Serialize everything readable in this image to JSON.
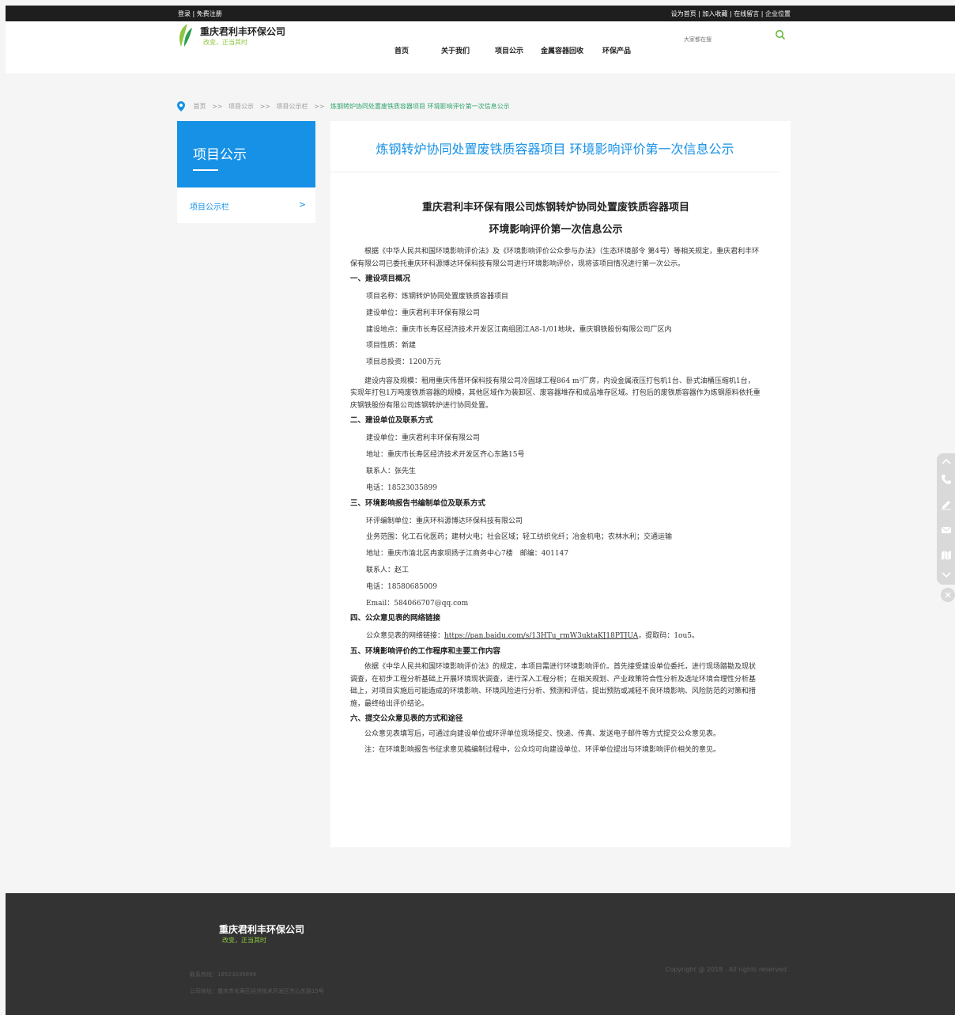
{
  "topbar": {
    "login": "登录",
    "register": "免费注册",
    "set_home": "设为首页",
    "favorite": "加入收藏",
    "message": "在线留言",
    "location": "企业位置",
    "sep": "|"
  },
  "header": {
    "company_name": "重庆君利丰环保公司",
    "slogan": "改变，正当其时",
    "search_placeholder": "大家都在搜",
    "nav": [
      "首页",
      "关于我们",
      "项目公示",
      "金属容器回收",
      "环保产品"
    ]
  },
  "breadcrumb": {
    "items": [
      "首页",
      "项目公示",
      "项目公示栏"
    ],
    "separator": ">>",
    "current": "炼钢转炉协同处置废铁质容器项目 环境影响评价第一次信息公示"
  },
  "sidebar": {
    "title": "项目公示",
    "item": "项目公示栏",
    "arrow": ">"
  },
  "article": {
    "page_title": "炼钢转炉协同处置废铁质容器项目 环境影响评价第一次信息公示",
    "title_line1": "重庆君利丰环保有限公司炼钢转炉协同处置废铁质容器项目",
    "title_line2": "环境影响评价第一次信息公示",
    "intro": "根据《中华人民共和国环境影响评价法》及《环境影响评价公众参与办法》（生态环境部令 第4号）等相关规定，重庆君利丰环保有限公司已委托重庆环科源博达环保科技有限公司进行环境影响评价，现将该项目情况进行第一次公示。",
    "s1_title": "一、建设项目概况",
    "s1_name": "项目名称：炼钢转炉协同处置废铁质容器项目",
    "s1_unit": "建设单位：重庆君利丰环保有限公司",
    "s1_place": "建设地点：重庆市长寿区经济技术开发区江南组团江A8-1/01地块，重庆钢铁股份有限公司厂区内",
    "s1_nature": "项目性质：新建",
    "s1_invest": "项目总投资：1200万元",
    "s1_scale": "建设内容及规模：租用重庆伟晋环保科技有限公司冷固球工程864 m²厂房，内设金属液压打包机1台、卧式油桶压缩机1台，实现年打包1万吨废铁质容器的规模，其他区域作为装卸区、废容器堆存和成品堆存区域。打包后的废铁质容器作为炼钢原料依托重庆钢铁股份有限公司炼钢转炉进行协同处置。",
    "s2_title": "二、建设单位及联系方式",
    "s2_unit": "建设单位：重庆君利丰环保有限公司",
    "s2_addr": "地址：重庆市长寿区经济技术开发区齐心东路15号",
    "s2_contact": "联系人：张先生",
    "s2_tel": "电话：18523035899",
    "s3_title": "三、环境影响报告书编制单位及联系方式",
    "s3_unit": "环评编制单位：重庆环科源博达环保科技有限公司",
    "s3_scope": "业务范围：化工石化医药；建材火电；社会区域；轻工纺织化纤；冶金机电；农林水利；交通运输",
    "s3_addr": "地址：重庆市渝北区冉家坝扬子江商务中心7楼　邮编：401147",
    "s3_contact": "联系人：赵工",
    "s3_tel": "电话：18580685009",
    "s3_email": "Email：584066707@qq.com",
    "s4_title": "四、公众意见表的网络链接",
    "s4_prefix": "公众意见表的网络链接：",
    "s4_link": "https://pan.baidu.com/s/13HTu_rmW3uktaKJ18PTJUA",
    "s4_suffix": "，提取码：1ou5。",
    "s5_title": "五、环境影响评价的工作程序和主要工作内容",
    "s5_text": "依据《中华人民共和国环境影响评价法》的规定，本项目需进行环境影响评价。首先接受建设单位委托，进行现场踏勘及现状调查，在初步工程分析基础上开展环境现状调查，进行深入工程分析；在相关规划、产业政策符合性分析及选址环境合理性分析基础上，对项目实施后可能造成的环境影响、环境风险进行分析、预测和评估，提出预防或减轻不良环境影响、风险防范的对策和措施，最终给出评价结论。",
    "s6_title": "六、提交公众意见表的方式和途径",
    "s6_text": "公众意见表填写后，可通过向建设单位或环评单位现场提交、快递、传真、发送电子邮件等方式提交公众意见表。",
    "s6_note": "注：在环境影响报告书征求意见稿编制过程中，公众均可向建设单位、环评单位提出与环境影响评价相关的意见。"
  },
  "footer": {
    "company_name": "重庆君利丰环保公司",
    "slogan": "改变，正当其时",
    "phone": "联系热线：18523035899",
    "address": "公司地址：重庆市长寿区经济技术开发区齐心东路15号",
    "copyright": "Copyright @ 2018 . All rights reserved"
  },
  "colors": {
    "accent": "#1791e6",
    "brand_green": "#8dc63f",
    "breadcrumb_current": "#2ea26a",
    "topbar": "#1e1e1e",
    "footer": "#333333"
  },
  "icons": [
    "leaf-logo-icon",
    "search-icon",
    "location-pin-icon",
    "chevron-up-icon",
    "phone-icon",
    "edit-icon",
    "mail-icon",
    "map-icon",
    "chevron-down-icon",
    "close-icon"
  ]
}
